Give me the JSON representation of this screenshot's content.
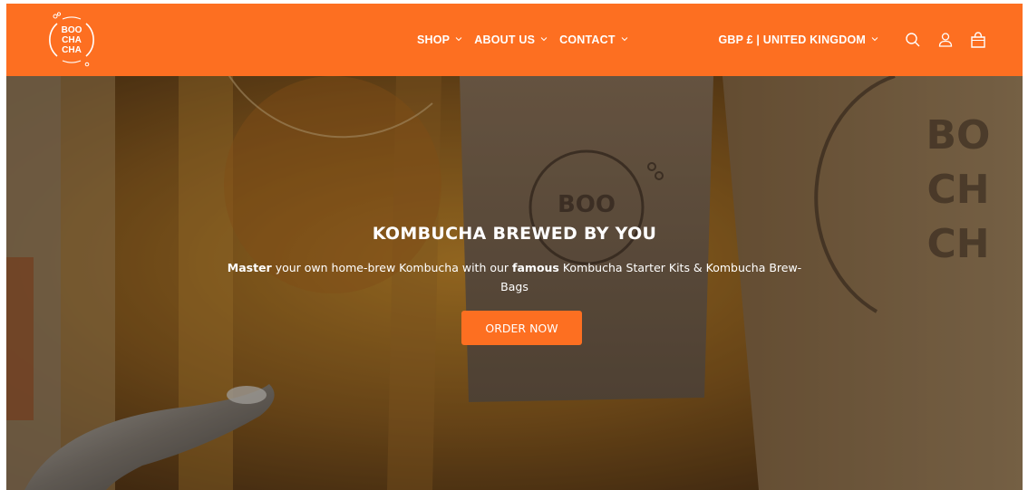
{
  "brand": {
    "logo_text": "BOO CHA CHA",
    "color": "#fd6f21"
  },
  "nav": {
    "items": [
      {
        "label": "SHOP",
        "has_dropdown": true
      },
      {
        "label": "ABOUT US",
        "has_dropdown": true
      },
      {
        "label": "CONTACT",
        "has_dropdown": true
      }
    ]
  },
  "tools": {
    "currency": "GBP £ | UNITED KINGDOM",
    "icons": [
      "search-icon",
      "account-icon",
      "cart-icon"
    ]
  },
  "hero": {
    "title": "KOMBUCHA BREWED BY YOU",
    "subtitle_parts": {
      "p1_bold": "Master",
      "p2": " your own home-brew Kombucha with our ",
      "p3_bold": "famous",
      "p4": " Kombucha Starter Kits & Kombucha Brew-Bags"
    },
    "cta_label": "ORDER NOW"
  }
}
